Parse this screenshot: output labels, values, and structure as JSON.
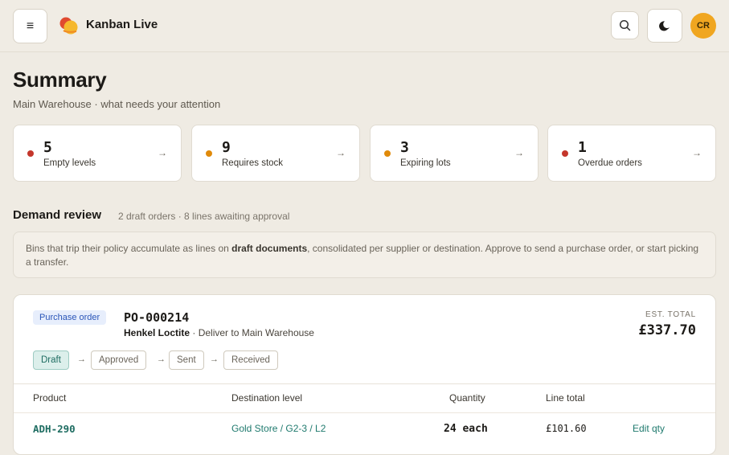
{
  "header": {
    "app_title": "Kanban Live",
    "menu_icon": "≡",
    "avatar_initials": "CR",
    "colors": {
      "avatar": "#f0a620",
      "logo_red": "#e04a2f",
      "logo_yellow": "#f5b82e"
    }
  },
  "summary": {
    "title": "Summary",
    "subtitle": "Main Warehouse · what needs your attention",
    "cards": [
      {
        "value": "5",
        "label": "Empty levels",
        "dot_color": "#c4362b"
      },
      {
        "value": "9",
        "label": "Requires stock",
        "dot_color": "#e08a0a"
      },
      {
        "value": "3",
        "label": "Expiring lots",
        "dot_color": "#e08a0a"
      },
      {
        "value": "1",
        "label": "Overdue orders",
        "dot_color": "#c4362b"
      }
    ],
    "arrow": "→"
  },
  "demand": {
    "title": "Demand review",
    "meta": "2 draft orders · 8 lines awaiting approval",
    "info_pre": "Bins that trip their policy accumulate as lines on ",
    "info_bold": "draft documents",
    "info_post": ", consolidated per supplier or destination. Approve to send a purchase order, or start picking a transfer."
  },
  "order": {
    "type": "Purchase order",
    "id": "PO-000214",
    "supplier": "Henkel Loctite",
    "deliver": " · Deliver to Main Warehouse",
    "est_label": "EST. TOTAL",
    "est_total": "£337.70",
    "steps": [
      "Draft",
      "Approved",
      "Sent",
      "Received"
    ],
    "step_arrow": "→",
    "columns": {
      "product": "Product",
      "destination": "Destination level",
      "quantity": "Quantity",
      "line_total": "Line total"
    },
    "rows": [
      {
        "sku": "ADH-290",
        "destination": "Gold Store / G2-3 / L2",
        "quantity": "24 each",
        "line_total": "£101.60",
        "action": "Edit qty"
      }
    ]
  }
}
